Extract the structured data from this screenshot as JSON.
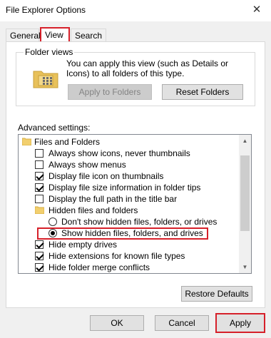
{
  "window": {
    "title": "File Explorer Options",
    "close_glyph": "✕"
  },
  "tabs": [
    {
      "label": "General"
    },
    {
      "label": "View"
    },
    {
      "label": "Search"
    }
  ],
  "folder_views": {
    "label": "Folder views",
    "description": "You can apply this view (such as Details or Icons) to all folders of this type.",
    "apply_label": "Apply to Folders",
    "reset_label": "Reset Folders"
  },
  "advanced": {
    "label": "Advanced settings:",
    "items": [
      {
        "label": "Files and Folders"
      },
      {
        "label": "Always show icons, never thumbnails"
      },
      {
        "label": "Always show menus"
      },
      {
        "label": "Display file icon on thumbnails"
      },
      {
        "label": "Display file size information in folder tips"
      },
      {
        "label": "Display the full path in the title bar"
      },
      {
        "label": "Hidden files and folders"
      },
      {
        "label": "Don't show hidden files, folders, or drives"
      },
      {
        "label": "Show hidden files, folders, and drives"
      },
      {
        "label": "Hide empty drives"
      },
      {
        "label": "Hide extensions for known file types"
      },
      {
        "label": "Hide folder merge conflicts"
      }
    ],
    "restore_label": "Restore Defaults"
  },
  "footer": {
    "ok_label": "OK",
    "cancel_label": "Cancel",
    "apply_label": "Apply"
  }
}
